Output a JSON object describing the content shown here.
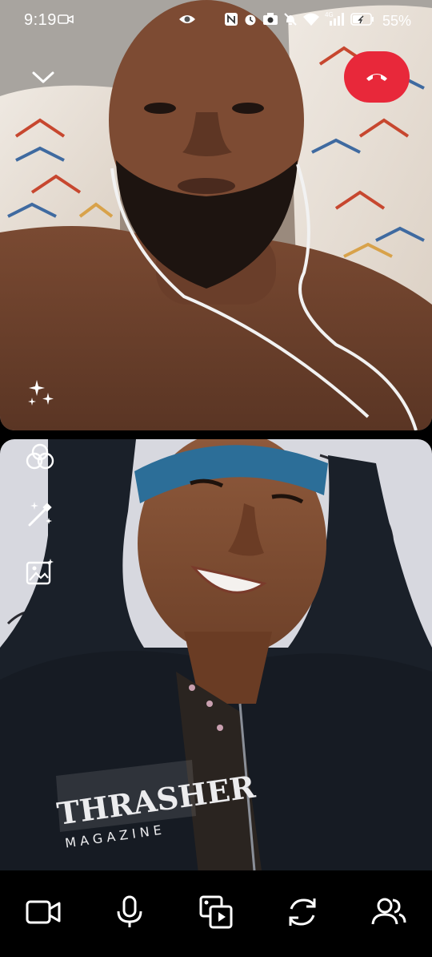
{
  "status_bar": {
    "time": "9:19",
    "battery": "55%",
    "network": "4G",
    "icons": [
      "video-recording-icon",
      "eye-icon",
      "nfc-icon",
      "alarm-icon",
      "camera-icon",
      "mute-icon",
      "wifi-icon",
      "signal-icon",
      "battery-icon"
    ]
  },
  "call": {
    "remote_video": "video-feed",
    "local_video": "video-feed",
    "end_call_color": "#e8283a"
  },
  "remote_controls": [
    "chevron-down-icon",
    "end-call-icon",
    "sparkles-effects-icon"
  ],
  "local_tools": [
    "color-filter-icon",
    "magic-wand-icon",
    "image-background-icon"
  ],
  "bottom_bar": [
    "video-camera-icon",
    "microphone-icon",
    "media-share-icon",
    "flip-camera-icon",
    "participants-icon"
  ]
}
